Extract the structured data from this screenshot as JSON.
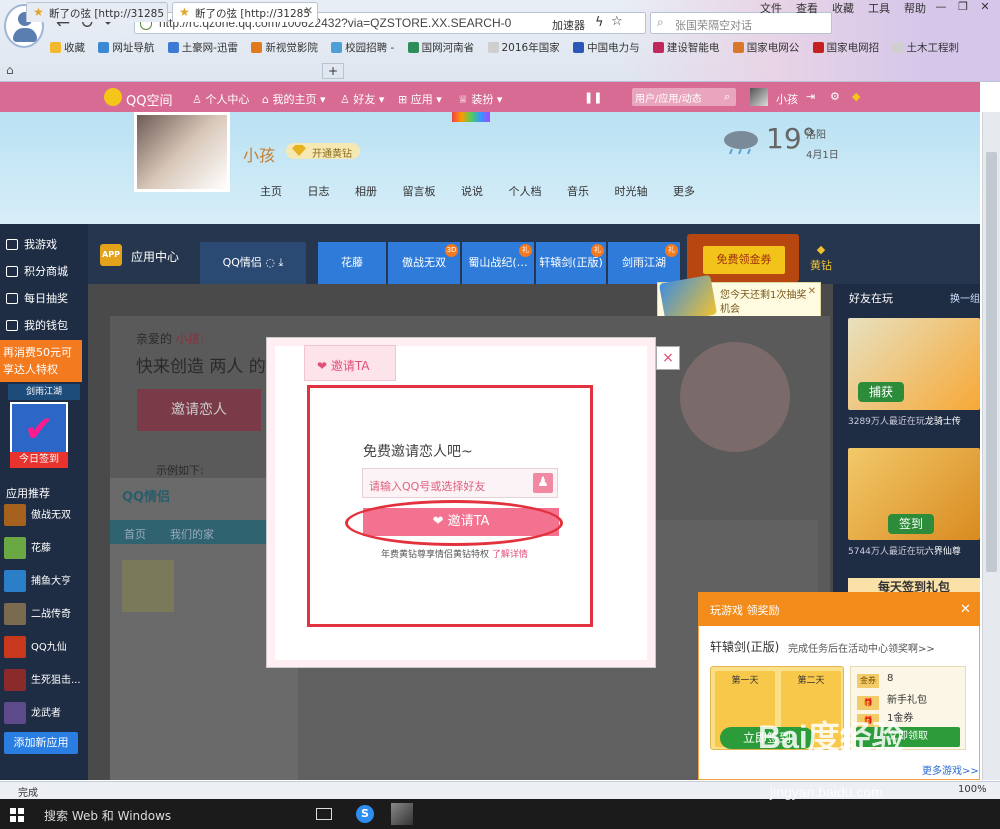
{
  "browser": {
    "url": "http://rc.qzone.qq.com/100622432?via=QZSTORE.XX.SEARCH-0",
    "accelerator": "加速器",
    "search_text": "张国荣隔空对话",
    "menu": [
      "文件",
      "查看",
      "收藏",
      "工具",
      "帮助"
    ],
    "bookmarks": [
      "收藏",
      "网址导航",
      "土豪网-迅雷",
      "新视觉影院",
      "校园招聘 -",
      "国网河南省",
      "2016年国家",
      "中国电力与",
      "建设智能电",
      "国家电网公",
      "国家电网招",
      "土木工程刺"
    ],
    "tabs": [
      "断了の弦 [http://31285",
      "断了の弦 [http://31285"
    ],
    "status": "完成",
    "zoom": "100%"
  },
  "qzone": {
    "logo": "QQ空间",
    "nav": [
      "个人中心",
      "我的主页",
      "好友",
      "应用",
      "装扮"
    ],
    "search_placeholder": "用户/应用/动态",
    "user_short": "小孩"
  },
  "profile": {
    "name": "小孩",
    "vip_label": "开通黄钻",
    "tabs": [
      "主页",
      "日志",
      "相册",
      "留言板",
      "说说",
      "个人档",
      "音乐",
      "时光轴",
      "更多"
    ],
    "weather_temp": "19°",
    "weather_city": "洛阳",
    "weather_date": "4月1日"
  },
  "left_sidebar": {
    "items": [
      "我游戏",
      "积分商城",
      "每日抽奖",
      "我的钱包"
    ],
    "promo": "再消费50元可享达人特权",
    "promo_tag": "剑雨江湖",
    "sign_label": "今日签到",
    "rec_title": "应用推荐",
    "games": [
      "傲战无双",
      "花藤",
      "捕鱼大亨",
      "二战传奇",
      "QQ九仙",
      "生死狙击...",
      "龙武者"
    ],
    "add_app": "添加新应用"
  },
  "app_center": {
    "title": "应用中心",
    "tabs": [
      "QQ情侣",
      "花藤",
      "傲战无双",
      "蜀山战纪(…",
      "轩辕剑(正版)",
      "剑雨江湖"
    ],
    "free_coupon": "免费领金券",
    "diamond": "黄钻",
    "lottery_tip": "您今天还剩1次抽奖机会"
  },
  "right_panel": {
    "title": "好友在玩",
    "switch": "换一组",
    "cards": [
      {
        "players": "3289万人最近在玩",
        "game": "龙骑士传",
        "img_label": "捕获"
      },
      {
        "players": "5744万人最近在玩",
        "game": "六界仙尊",
        "img_label": "签到"
      }
    ],
    "card3_label": "每天签到礼包"
  },
  "background_page": {
    "greeting": "亲爱的",
    "greeting_name": "小孩:",
    "headline": "快来创造 两人 的",
    "invite_btn": "邀请恋人",
    "example": "示例如下:",
    "card_tabs": [
      "首页",
      "我们的家"
    ]
  },
  "modal": {
    "tab_label": "邀请TA",
    "title": "免费邀请恋人吧~",
    "input_placeholder": "请输入QQ号或选择好友",
    "invite_button": "邀请TA",
    "note": "年费黄钻尊享情侣黄钻特权",
    "note_link": "了解详情",
    "close": "×"
  },
  "game_popup": {
    "header": "玩游戏 领奖励",
    "game": "轩辕剑(正版)",
    "desc": "完成任务后在活动中心领奖啊>>",
    "day1": "第一天",
    "day2": "第二天",
    "sign": "立即签到",
    "reward_coin": "金券",
    "reward_coin_count": "8",
    "reward_pack": "新手礼包",
    "reward_pack2": "1金券",
    "claim": "立即领取",
    "more": "更多游戏>>"
  },
  "taskbar": {
    "search": "搜索 Web 和 Windows"
  },
  "watermark": {
    "main": "Bai度经验",
    "sub": "jingyan.baidu.com"
  }
}
